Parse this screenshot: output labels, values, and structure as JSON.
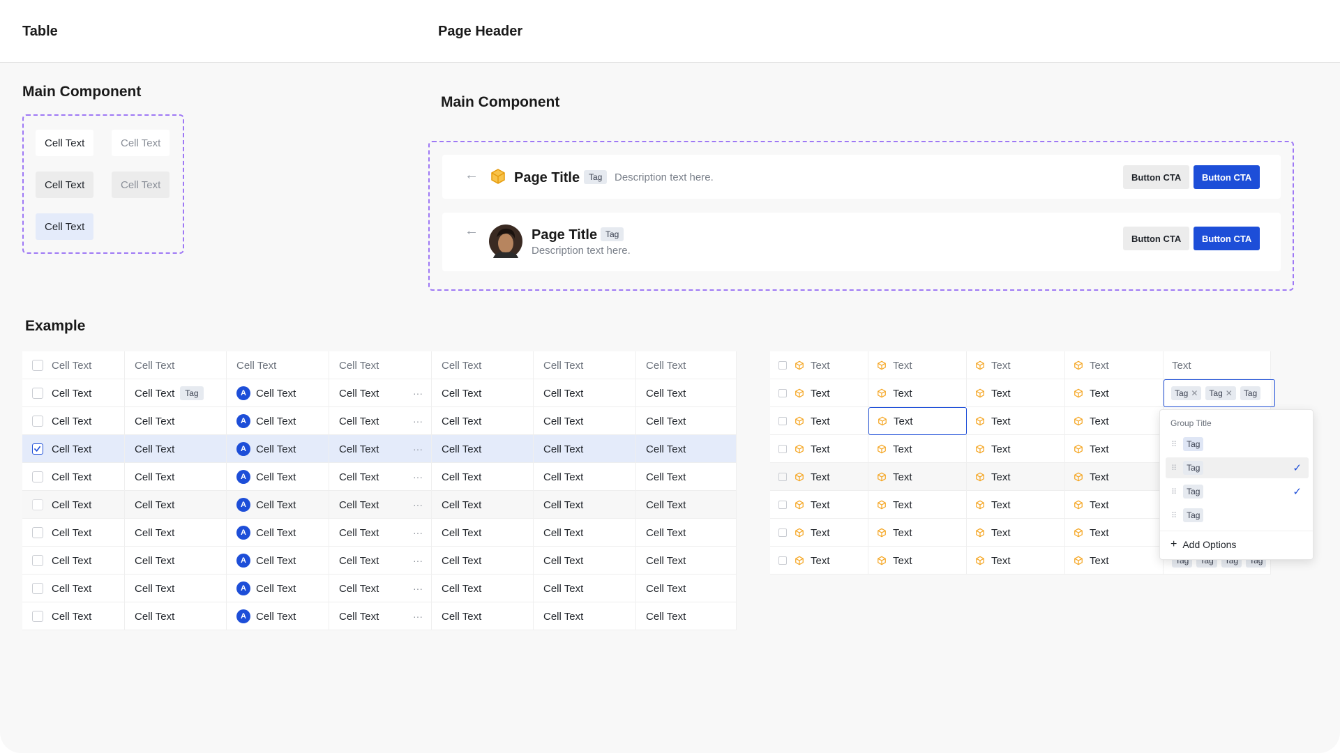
{
  "header": {
    "left_title": "Table",
    "right_title": "Page Header"
  },
  "table_section": {
    "main_component_title": "Main Component",
    "cells": [
      "Cell Text",
      "Cell Text",
      "Cell Text",
      "Cell Text",
      "Cell Text"
    ]
  },
  "page_header_section": {
    "main_component_title": "Main Component",
    "variant1": {
      "title": "Page Title",
      "tag": "Tag",
      "description": "Description text here.",
      "btn_secondary": "Button CTA",
      "btn_primary": "Button CTA"
    },
    "variant2": {
      "title": "Page Title",
      "tag": "Tag",
      "description": "Description text here.",
      "btn_secondary": "Button CTA",
      "btn_primary": "Button CTA"
    }
  },
  "example": {
    "title": "Example",
    "table1": {
      "header": [
        "Cell Text",
        "Cell Text",
        "Cell Text",
        "Cell Text",
        "Cell Text",
        "Cell Text",
        "Cell Text",
        "Cell Text"
      ],
      "cell_text": "Cell Text",
      "avatar_letter": "A",
      "tag": "Tag",
      "more": "···"
    },
    "table2": {
      "header": [
        "Text",
        "Text",
        "Text",
        "Text",
        "Text"
      ],
      "cell_text": "Text",
      "tags": [
        "Tag",
        "Tag",
        "Tag"
      ],
      "tail_tags": [
        "Tag",
        "Tag",
        "Tag",
        "Tag"
      ]
    },
    "dropdown": {
      "group_title": "Group Title",
      "items": [
        "Tag",
        "Tag",
        "Tag",
        "Tag"
      ],
      "add_label": "Add Options"
    }
  },
  "colors": {
    "accent": "#1d4ed8",
    "dashed": "#9e78f5",
    "cube": "#f5a623"
  }
}
